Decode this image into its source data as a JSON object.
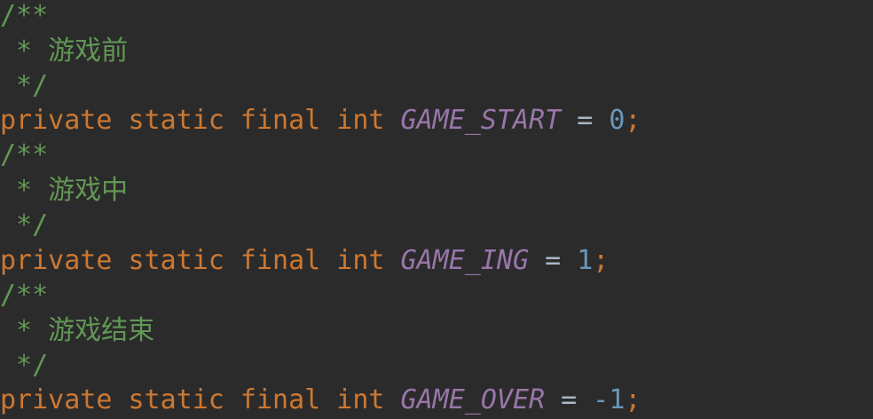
{
  "editor": {
    "blocks": [
      {
        "comment_open": "/**",
        "comment_text": " * 游戏前",
        "comment_close": " */",
        "decl": {
          "modifiers": "private static final int",
          "name": "GAME_START",
          "equals": "=",
          "value": "0",
          "semicolon": ";"
        }
      },
      {
        "comment_open": "/**",
        "comment_text": " * 游戏中",
        "comment_close": " */",
        "decl": {
          "modifiers": "private static final int",
          "name": "GAME_ING",
          "equals": "=",
          "value": "1",
          "semicolon": ";"
        }
      },
      {
        "comment_open": "/**",
        "comment_text": " * 游戏结束",
        "comment_close": " */",
        "decl": {
          "modifiers": "private static final int",
          "name": "GAME_OVER",
          "equals": "=",
          "value": "-1",
          "semicolon": ";"
        }
      }
    ]
  },
  "colors": {
    "background": "#2b2b2b",
    "comment": "#629755",
    "keyword": "#cc7832",
    "constant": "#9876aa",
    "number": "#6897bb",
    "text": "#a9b7c6"
  }
}
